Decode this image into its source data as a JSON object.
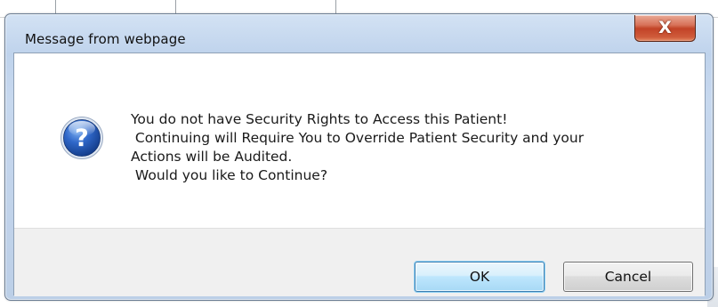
{
  "dialog": {
    "title": "Message from webpage",
    "close_glyph": "X",
    "icon": "question-icon",
    "message_lines": [
      "You do not have Security Rights to Access this Patient!",
      " Continuing will Require You to Override Patient Security and your",
      "Actions will be Audited.",
      " Would you like to Continue?"
    ],
    "ok_label": "OK",
    "cancel_label": "Cancel"
  },
  "colors": {
    "title_bar": "#c7d8ee",
    "close_button": "#c24327",
    "ok_border": "#3c7fb1",
    "icon_blue": "#1f4fb0",
    "button_area": "#f0f0f0"
  }
}
